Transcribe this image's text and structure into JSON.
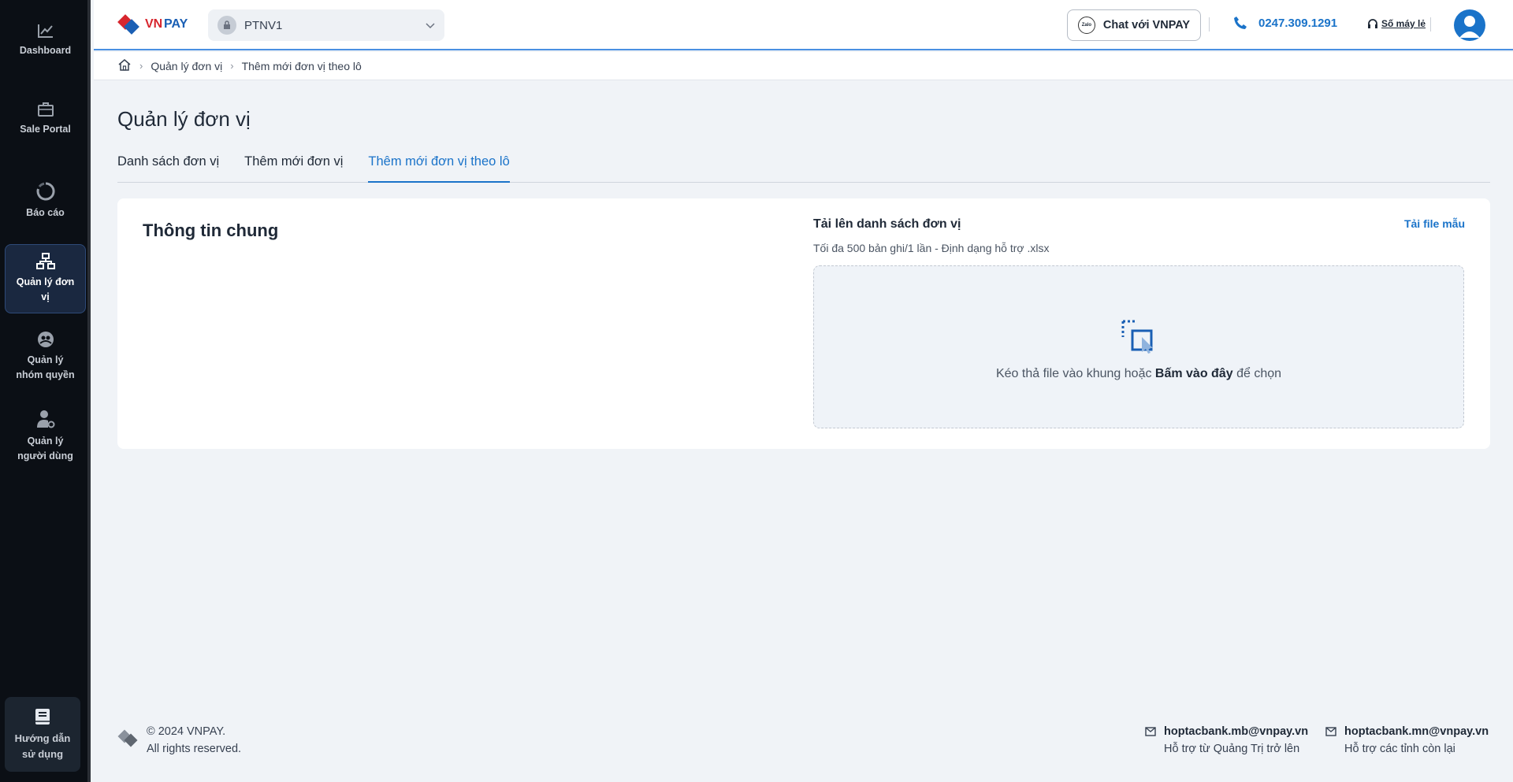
{
  "sidebar": {
    "items": [
      {
        "label": "Dashboard",
        "icon": "chart-line-icon"
      },
      {
        "label": "Sale Portal",
        "icon": "briefcase-icon"
      },
      {
        "label": "Báo cáo",
        "icon": "report-circle-icon"
      },
      {
        "label": "Quản lý đơn vị",
        "icon": "org-chart-icon",
        "active": true
      },
      {
        "label": "Quản lý nhóm quyền",
        "icon": "group-icon"
      },
      {
        "label": "Quản lý người dùng",
        "icon": "user-settings-icon"
      }
    ],
    "help": {
      "label": "Hướng dẫn sử dụng",
      "icon": "book-icon"
    }
  },
  "header": {
    "unit_select_value": "PTNV1",
    "chat_label": "Chat với VNPAY",
    "phone": "0247.309.1291",
    "extension_label": "Số máy lẻ"
  },
  "breadcrumb": {
    "items": [
      "Quản lý đơn vị",
      "Thêm mới đơn vị theo lô"
    ]
  },
  "page": {
    "title": "Quản lý đơn vị",
    "tabs": [
      {
        "label": "Danh sách đơn vị",
        "active": false
      },
      {
        "label": "Thêm mới đơn vị",
        "active": false
      },
      {
        "label": "Thêm mới đơn vị theo lô",
        "active": true
      }
    ]
  },
  "card": {
    "section_title": "Thông tin chung",
    "upload_title": "Tải lên danh sách đơn vị",
    "sample_link": "Tải file mẫu",
    "upload_hint": "Tối đa 500 bản ghi/1 lần - Định dạng hỗ trợ .xlsx",
    "drop_text_before": "Kéo thả file vào khung hoặc ",
    "drop_text_link": "Bấm vào đây",
    "drop_text_after": " để chọn"
  },
  "footer": {
    "copyright_line1": "© 2024 VNPAY.",
    "copyright_line2": "All rights reserved.",
    "contacts": [
      {
        "email": "hoptacbank.mb@vnpay.vn",
        "note": "Hỗ trợ từ Quảng Trị trở lên"
      },
      {
        "email": "hoptacbank.mn@vnpay.vn",
        "note": "Hỗ trợ các tỉnh còn lại"
      }
    ]
  },
  "colors": {
    "accent": "#1a73c9",
    "sidebar_bg": "#0b0f15",
    "page_bg": "#f0f3f7"
  }
}
